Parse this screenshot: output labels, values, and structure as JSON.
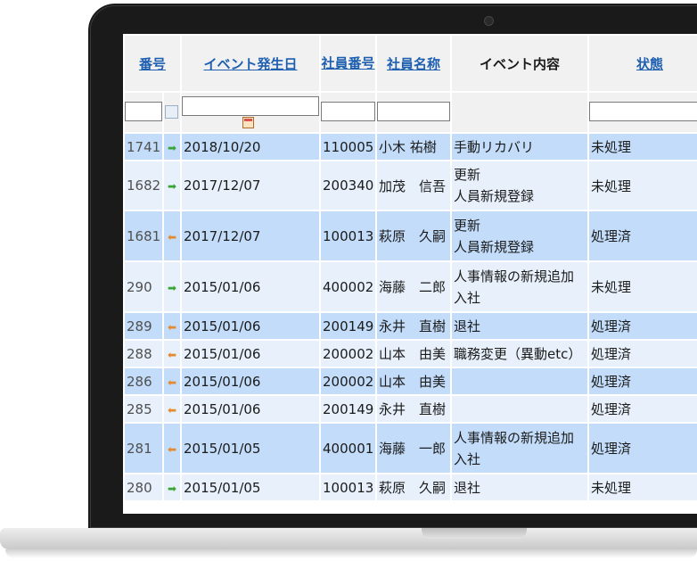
{
  "headers": {
    "no": "番号",
    "date": "イベント発生日",
    "emp_no": "社員番号",
    "emp_name": "社員名称",
    "event": "イベント内容",
    "status": "状態"
  },
  "rows": [
    {
      "no": "1741",
      "arrow": "green",
      "date": "2018/10/20",
      "emp": "110005",
      "name": "小木 祐樹",
      "event_l1": "手動リカバリ",
      "event_l2": "",
      "status": "未処理"
    },
    {
      "no": "1682",
      "arrow": "green",
      "date": "2017/12/07",
      "emp": "200340",
      "name": "加茂　信吾",
      "event_l1": "更新",
      "event_l2": "人員新規登録",
      "status": "未処理"
    },
    {
      "no": "1681",
      "arrow": "orange",
      "date": "2017/12/07",
      "emp": "100013",
      "name": "萩原　久嗣",
      "event_l1": "更新",
      "event_l2": "人員新規登録",
      "status": "処理済"
    },
    {
      "no": "290",
      "arrow": "green",
      "date": "2015/01/06",
      "emp": "400002",
      "name": "海藤　二郎",
      "event_l1": "人事情報の新規追加",
      "event_l2": "入社",
      "status": "未処理"
    },
    {
      "no": "289",
      "arrow": "orange",
      "date": "2015/01/06",
      "emp": "200149",
      "name": "永井　直樹",
      "event_l1": "退社",
      "event_l2": "",
      "status": "処理済"
    },
    {
      "no": "288",
      "arrow": "orange",
      "date": "2015/01/06",
      "emp": "200002",
      "name": "山本　由美",
      "event_l1": "職務変更（異動etc）",
      "event_l2": "",
      "status": "処理済"
    },
    {
      "no": "286",
      "arrow": "orange",
      "date": "2015/01/06",
      "emp": "200002",
      "name": "山本　由美",
      "event_l1": "",
      "event_l2": "",
      "status": "処理済"
    },
    {
      "no": "285",
      "arrow": "orange",
      "date": "2015/01/06",
      "emp": "200149",
      "name": "永井　直樹",
      "event_l1": "",
      "event_l2": "",
      "status": "処理済"
    },
    {
      "no": "281",
      "arrow": "orange",
      "date": "2015/01/05",
      "emp": "400001",
      "name": "海藤　一郎",
      "event_l1": "人事情報の新規追加",
      "event_l2": "入社",
      "status": "処理済"
    },
    {
      "no": "280",
      "arrow": "green",
      "date": "2015/01/05",
      "emp": "100013",
      "name": "萩原　久嗣",
      "event_l1": "退社",
      "event_l2": "",
      "status": "未処理"
    }
  ],
  "colors": {
    "row_odd": "#c2dcfa",
    "row_even": "#e7f0fb",
    "header_link": "#1e5fb0",
    "arrow_green": "#3aa435",
    "arrow_orange": "#e58a2e"
  }
}
